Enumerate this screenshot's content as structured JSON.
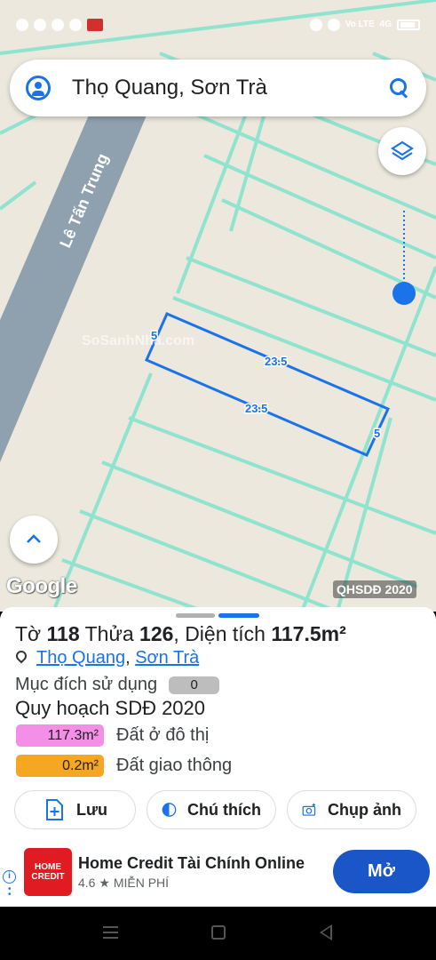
{
  "statusbar": {
    "volte": "Vo LTE",
    "network": "4G"
  },
  "search": {
    "query": "Thọ Quang, Sơn Trà"
  },
  "map": {
    "street_name": "Lê Tấn Trung",
    "edge_top": "23.5",
    "edge_bottom": "23.5",
    "edge_left": "5",
    "edge_right": "5",
    "watermark": "SoSanhNha.com",
    "google_logo": "Google",
    "layer_tag": "QHSDĐ 2020",
    "colors": {
      "parcel_outline": "#1a73e8",
      "lot_lines": "#8fe3cf",
      "road": "#8fa0ae"
    }
  },
  "sheet": {
    "title": {
      "to_label": "Tờ",
      "to_value": "118",
      "thua_label": "Thửa",
      "thua_value": "126",
      "area_label": ", Diện tích",
      "area_value": "117.5m²"
    },
    "location": {
      "ward": "Thọ Quang",
      "separator": ",",
      "district": "Sơn Trà"
    },
    "purpose": {
      "label": "Mục đích sử dụng",
      "value": "0"
    },
    "plan_title": "Quy hoạch SDĐ 2020",
    "plan_items": [
      {
        "area": "117.3m²",
        "label": "Đất ở đô thị",
        "color": "#f48fe8"
      },
      {
        "area": "0.2m²",
        "label": "Đất giao thông",
        "color": "#f5a623"
      }
    ],
    "actions": {
      "save": "Lưu",
      "legend": "Chú thích",
      "capture": "Chụp ảnh"
    }
  },
  "ad": {
    "logo_line1": "HOME",
    "logo_line2": "CREDIT",
    "title": "Home Credit Tài Chính Online",
    "rating": "4.6",
    "star": "★",
    "price": "MIỄN PHÍ",
    "button": "Mở",
    "info": "i"
  }
}
